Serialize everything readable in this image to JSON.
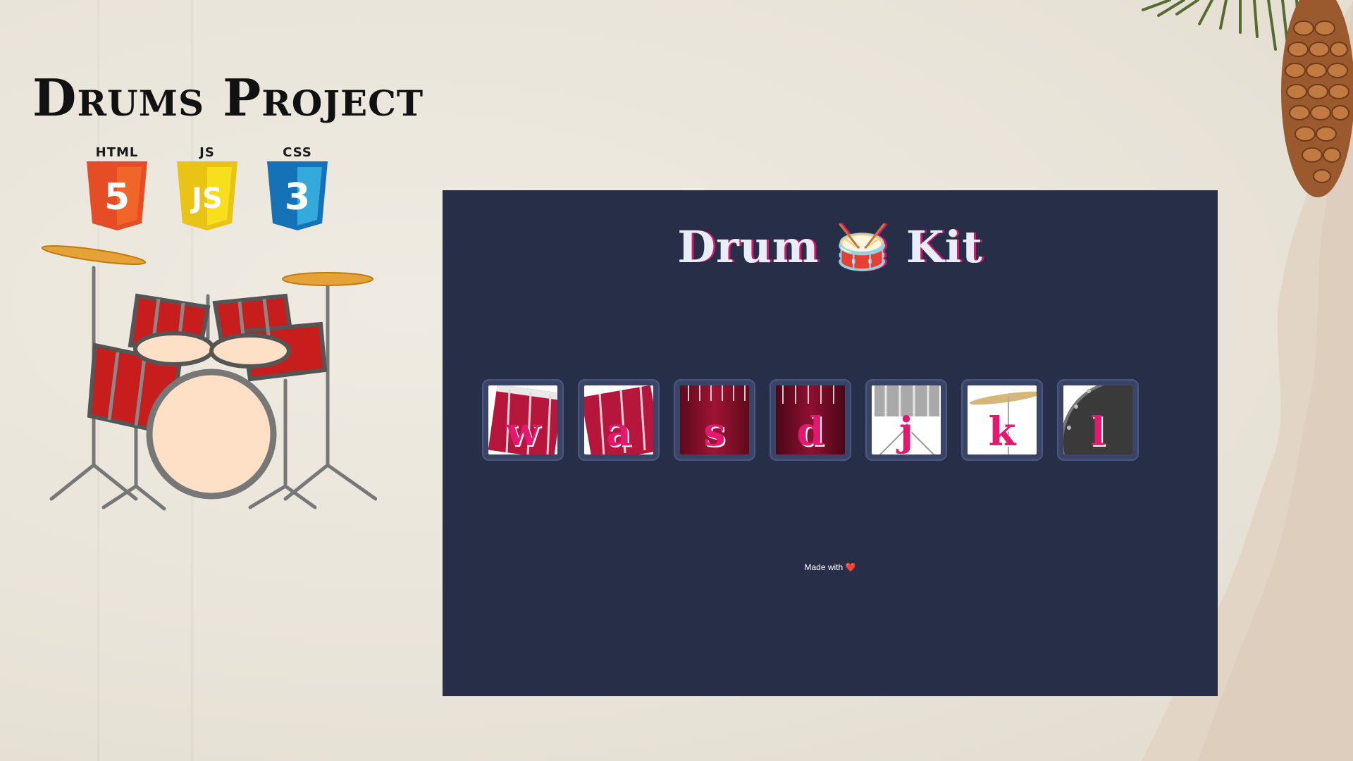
{
  "page": {
    "title": "Drums Project",
    "logos": [
      {
        "label": "HTML",
        "badge": "5",
        "color": "#e44d26",
        "shade": "#f16529"
      },
      {
        "label": "JS",
        "badge": "JS",
        "color": "#e9c416",
        "shade": "#f7df1e"
      },
      {
        "label": "CSS",
        "badge": "3",
        "color": "#1572b6",
        "shade": "#33a9dc"
      }
    ]
  },
  "app": {
    "title_left": "Drum",
    "title_emoji": "🥁",
    "title_right": "Kit",
    "drums": [
      {
        "key": "w",
        "icon": "tom-drum-icon"
      },
      {
        "key": "a",
        "icon": "tom-drum-icon"
      },
      {
        "key": "s",
        "icon": "snare-drum-icon"
      },
      {
        "key": "d",
        "icon": "bass-drum-icon"
      },
      {
        "key": "j",
        "icon": "snare-stand-icon"
      },
      {
        "key": "k",
        "icon": "cymbal-icon"
      },
      {
        "key": "l",
        "icon": "kick-drum-icon"
      }
    ],
    "footer_text": "Made with",
    "footer_heart": "❤️"
  },
  "colors": {
    "panel_bg": "#262e48",
    "accent_pink": "#e1196f",
    "title_text": "#e7eef8"
  }
}
